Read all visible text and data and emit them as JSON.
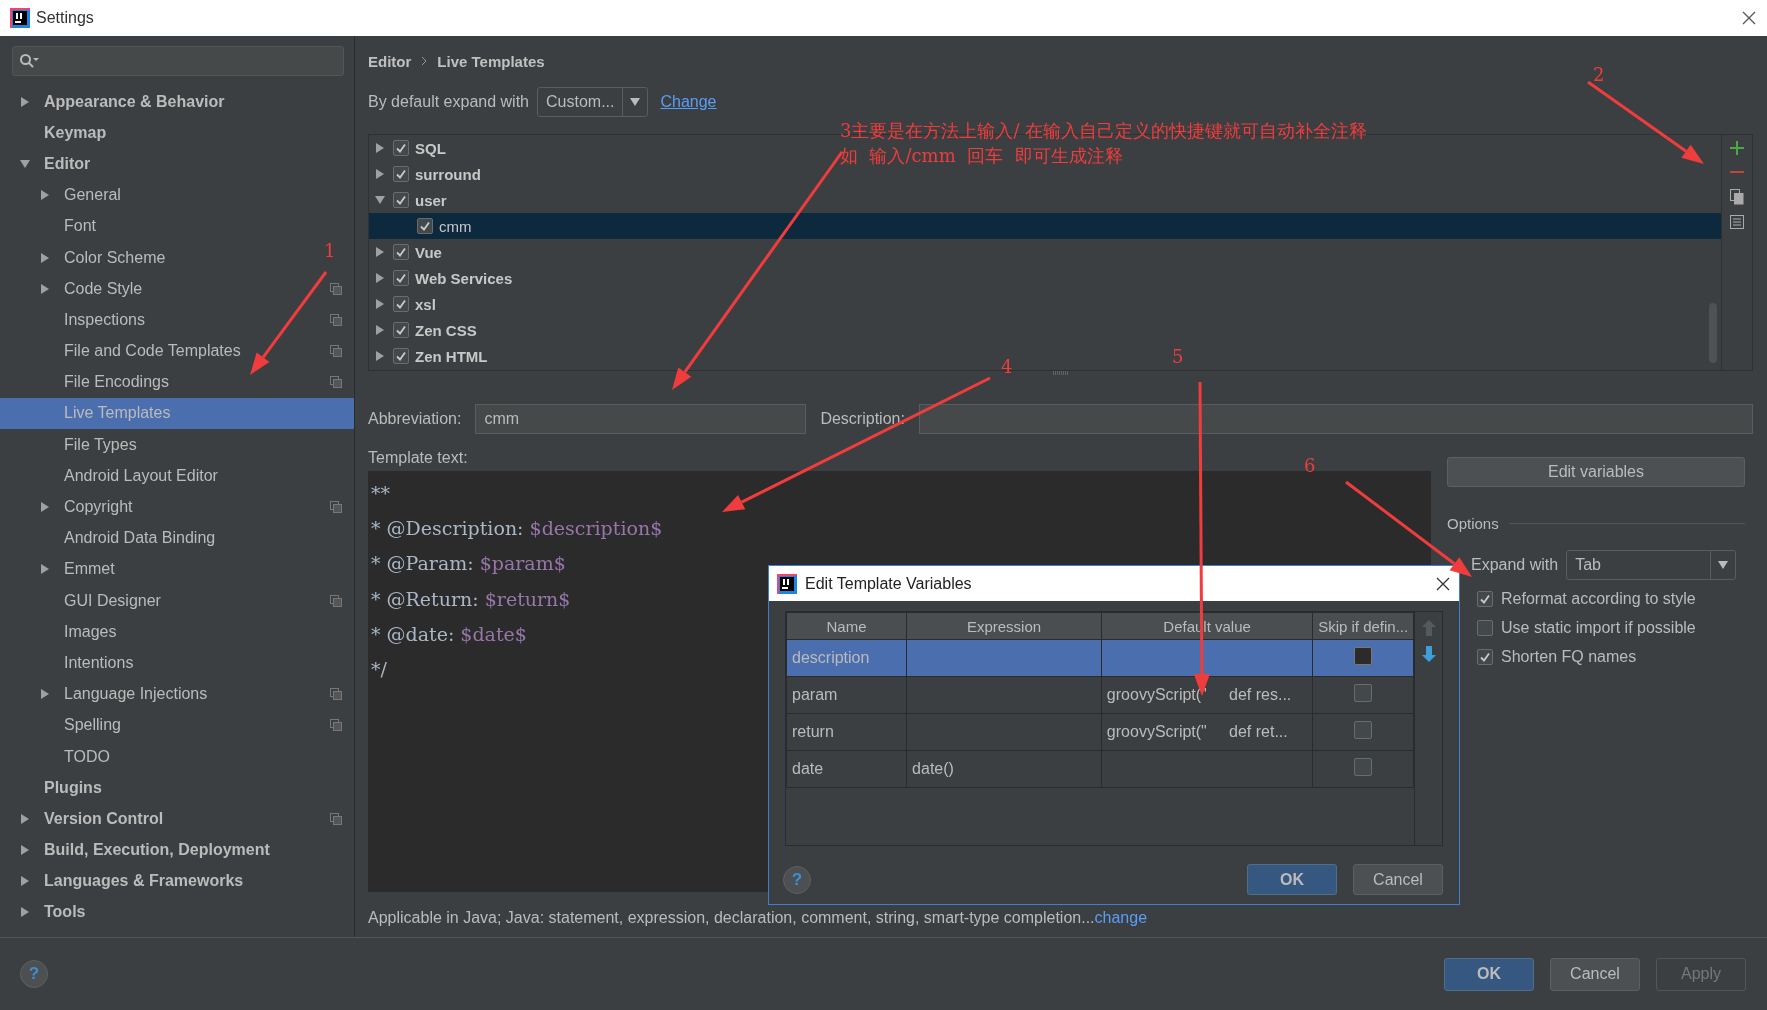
{
  "window": {
    "title": "Settings"
  },
  "sidebar": {
    "help_button": "?",
    "items": [
      {
        "label": "Appearance & Behavior",
        "expanded": false,
        "selected": false,
        "project_scope": false
      },
      {
        "label": "Keymap",
        "selected": false,
        "project_scope": false
      },
      {
        "label": "Editor",
        "expanded": true,
        "selected": false,
        "project_scope": false,
        "children": [
          {
            "label": "General",
            "expanded": false,
            "selected": false,
            "project_scope": false
          },
          {
            "label": "Font",
            "selected": false,
            "project_scope": false
          },
          {
            "label": "Color Scheme",
            "expanded": false,
            "selected": false,
            "project_scope": false
          },
          {
            "label": "Code Style",
            "expanded": false,
            "selected": false,
            "project_scope": true
          },
          {
            "label": "Inspections",
            "selected": false,
            "project_scope": true
          },
          {
            "label": "File and Code Templates",
            "selected": false,
            "project_scope": true
          },
          {
            "label": "File Encodings",
            "selected": false,
            "project_scope": true
          },
          {
            "label": "Live Templates",
            "selected": true,
            "project_scope": false
          },
          {
            "label": "File Types",
            "selected": false,
            "project_scope": false
          },
          {
            "label": "Android Layout Editor",
            "selected": false,
            "project_scope": false
          },
          {
            "label": "Copyright",
            "expanded": false,
            "selected": false,
            "project_scope": true
          },
          {
            "label": "Android Data Binding",
            "selected": false,
            "project_scope": false
          },
          {
            "label": "Emmet",
            "expanded": false,
            "selected": false,
            "project_scope": false
          },
          {
            "label": "GUI Designer",
            "selected": false,
            "project_scope": true
          },
          {
            "label": "Images",
            "selected": false,
            "project_scope": false
          },
          {
            "label": "Intentions",
            "selected": false,
            "project_scope": false
          },
          {
            "label": "Language Injections",
            "expanded": false,
            "selected": false,
            "project_scope": true
          },
          {
            "label": "Spelling",
            "selected": false,
            "project_scope": true
          },
          {
            "label": "TODO",
            "selected": false,
            "project_scope": false
          }
        ]
      },
      {
        "label": "Plugins",
        "selected": false,
        "project_scope": false
      },
      {
        "label": "Version Control",
        "expanded": false,
        "selected": false,
        "project_scope": true
      },
      {
        "label": "Build, Execution, Deployment",
        "expanded": false,
        "selected": false,
        "project_scope": false
      },
      {
        "label": "Languages & Frameworks",
        "expanded": false,
        "selected": false,
        "project_scope": false
      },
      {
        "label": "Tools",
        "expanded": false,
        "selected": false,
        "project_scope": false
      }
    ]
  },
  "breadcrumb": [
    "Editor",
    "Live Templates"
  ],
  "expand_default": {
    "label": "By default expand with",
    "value": "Custom...",
    "link": "Change"
  },
  "templates": [
    {
      "label": "SQL",
      "expanded": false,
      "checked": true,
      "selected": false
    },
    {
      "label": "surround",
      "expanded": false,
      "checked": true,
      "selected": false
    },
    {
      "label": "user",
      "expanded": true,
      "checked": true,
      "selected": false,
      "children": [
        {
          "label": "cmm",
          "checked": true,
          "selected": true
        }
      ]
    },
    {
      "label": "Vue",
      "expanded": false,
      "checked": true,
      "selected": false
    },
    {
      "label": "Web Services",
      "expanded": false,
      "checked": true,
      "selected": false
    },
    {
      "label": "xsl",
      "expanded": false,
      "checked": true,
      "selected": false
    },
    {
      "label": "Zen CSS",
      "expanded": false,
      "checked": true,
      "selected": false
    },
    {
      "label": "Zen HTML",
      "expanded": false,
      "checked": true,
      "selected": false
    }
  ],
  "abbreviation": {
    "label": "Abbreviation:",
    "value": "cmm"
  },
  "description": {
    "label": "Description:"
  },
  "template_text": {
    "label": "Template text:",
    "lines": [
      [
        {
          "kind": "plain",
          "text": "**"
        }
      ],
      [
        {
          "kind": "plain",
          "text": "* @Description: "
        },
        {
          "kind": "variable",
          "text": "$description$"
        }
      ],
      [
        {
          "kind": "plain",
          "text": "* @Param: "
        },
        {
          "kind": "variable",
          "text": "$param$"
        }
      ],
      [
        {
          "kind": "plain",
          "text": "* @Return: "
        },
        {
          "kind": "variable",
          "text": "$return$"
        }
      ],
      [
        {
          "kind": "plain",
          "text": "* @date: "
        },
        {
          "kind": "variable",
          "text": "$date$"
        }
      ],
      [
        {
          "kind": "plain",
          "text": "*/"
        }
      ]
    ]
  },
  "applicable": {
    "text": "Applicable in Java; Java: statement, expression, declaration, comment, string, smart-type completion...",
    "link": "change"
  },
  "edit_variables_button": "Edit variables",
  "options": {
    "title": "Options",
    "expand_with": {
      "label": "Expand with",
      "value": "Tab"
    },
    "checkboxes": [
      {
        "label": "Reformat according to style",
        "checked": true
      },
      {
        "label": "Use static import if possible",
        "checked": false
      },
      {
        "label": "Shorten FQ names",
        "checked": true
      }
    ]
  },
  "dialog": {
    "title": "Edit Template Variables",
    "columns": [
      "Name",
      "Expression",
      "Default value",
      "Skip if defin..."
    ],
    "rows": [
      {
        "name": "description",
        "expression": "",
        "default_value": "",
        "skip": false,
        "selected": true
      },
      {
        "name": "param",
        "expression": "",
        "default_value": "groovyScript(\"     def res...",
        "skip": false,
        "selected": false
      },
      {
        "name": "return",
        "expression": "",
        "default_value": "groovyScript(\"     def ret...",
        "skip": false,
        "selected": false
      },
      {
        "name": "date",
        "expression": "date()",
        "default_value": "",
        "skip": false,
        "selected": false
      }
    ],
    "help_button": "?",
    "buttons": [
      {
        "label": "OK",
        "kind": "primary"
      },
      {
        "label": "Cancel",
        "kind": "normal"
      }
    ]
  },
  "buttons": [
    {
      "label": "OK",
      "kind": "primary",
      "disabled": false
    },
    {
      "label": "Cancel",
      "kind": "normal",
      "disabled": false
    },
    {
      "label": "Apply",
      "kind": "normal",
      "disabled": true
    }
  ],
  "annotations": [
    {
      "text": "1"
    },
    {
      "text": "2"
    },
    {
      "text": "3主要是在方法上输入/ 在输入自己定义的快捷键就可自动补全注释"
    },
    {
      "text": "如  输入/cmm  回车  即可生成注释"
    },
    {
      "text": "4"
    },
    {
      "text": "5"
    },
    {
      "text": "6"
    }
  ]
}
